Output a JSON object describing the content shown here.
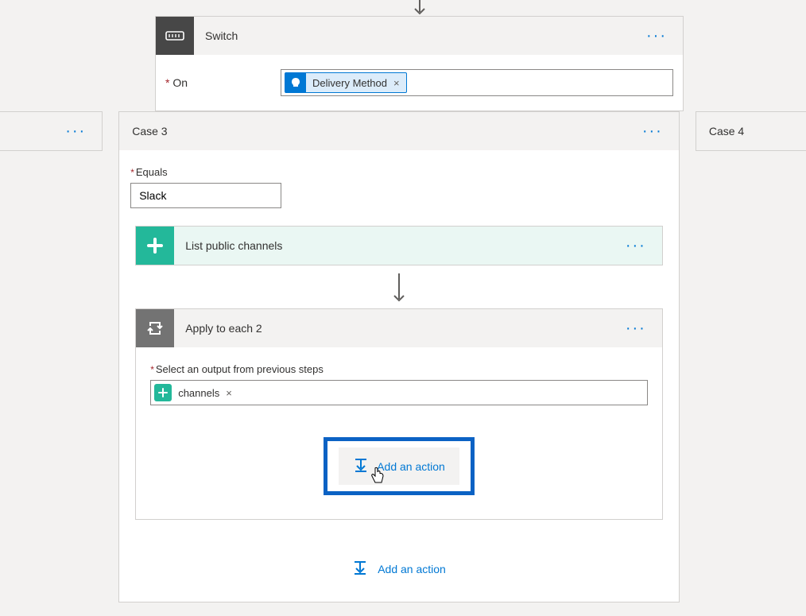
{
  "switch": {
    "title": "Switch",
    "on_label": "On",
    "token_label": "Delivery Method"
  },
  "case3": {
    "title": "Case 3",
    "equals_label": "Equals",
    "equals_value": "Slack"
  },
  "case4": {
    "title": "Case 4"
  },
  "slack_action": {
    "title": "List public channels"
  },
  "apply": {
    "title": "Apply to each 2",
    "select_label": "Select an output from previous steps",
    "token_label": "channels"
  },
  "buttons": {
    "add_action": "Add an action"
  }
}
